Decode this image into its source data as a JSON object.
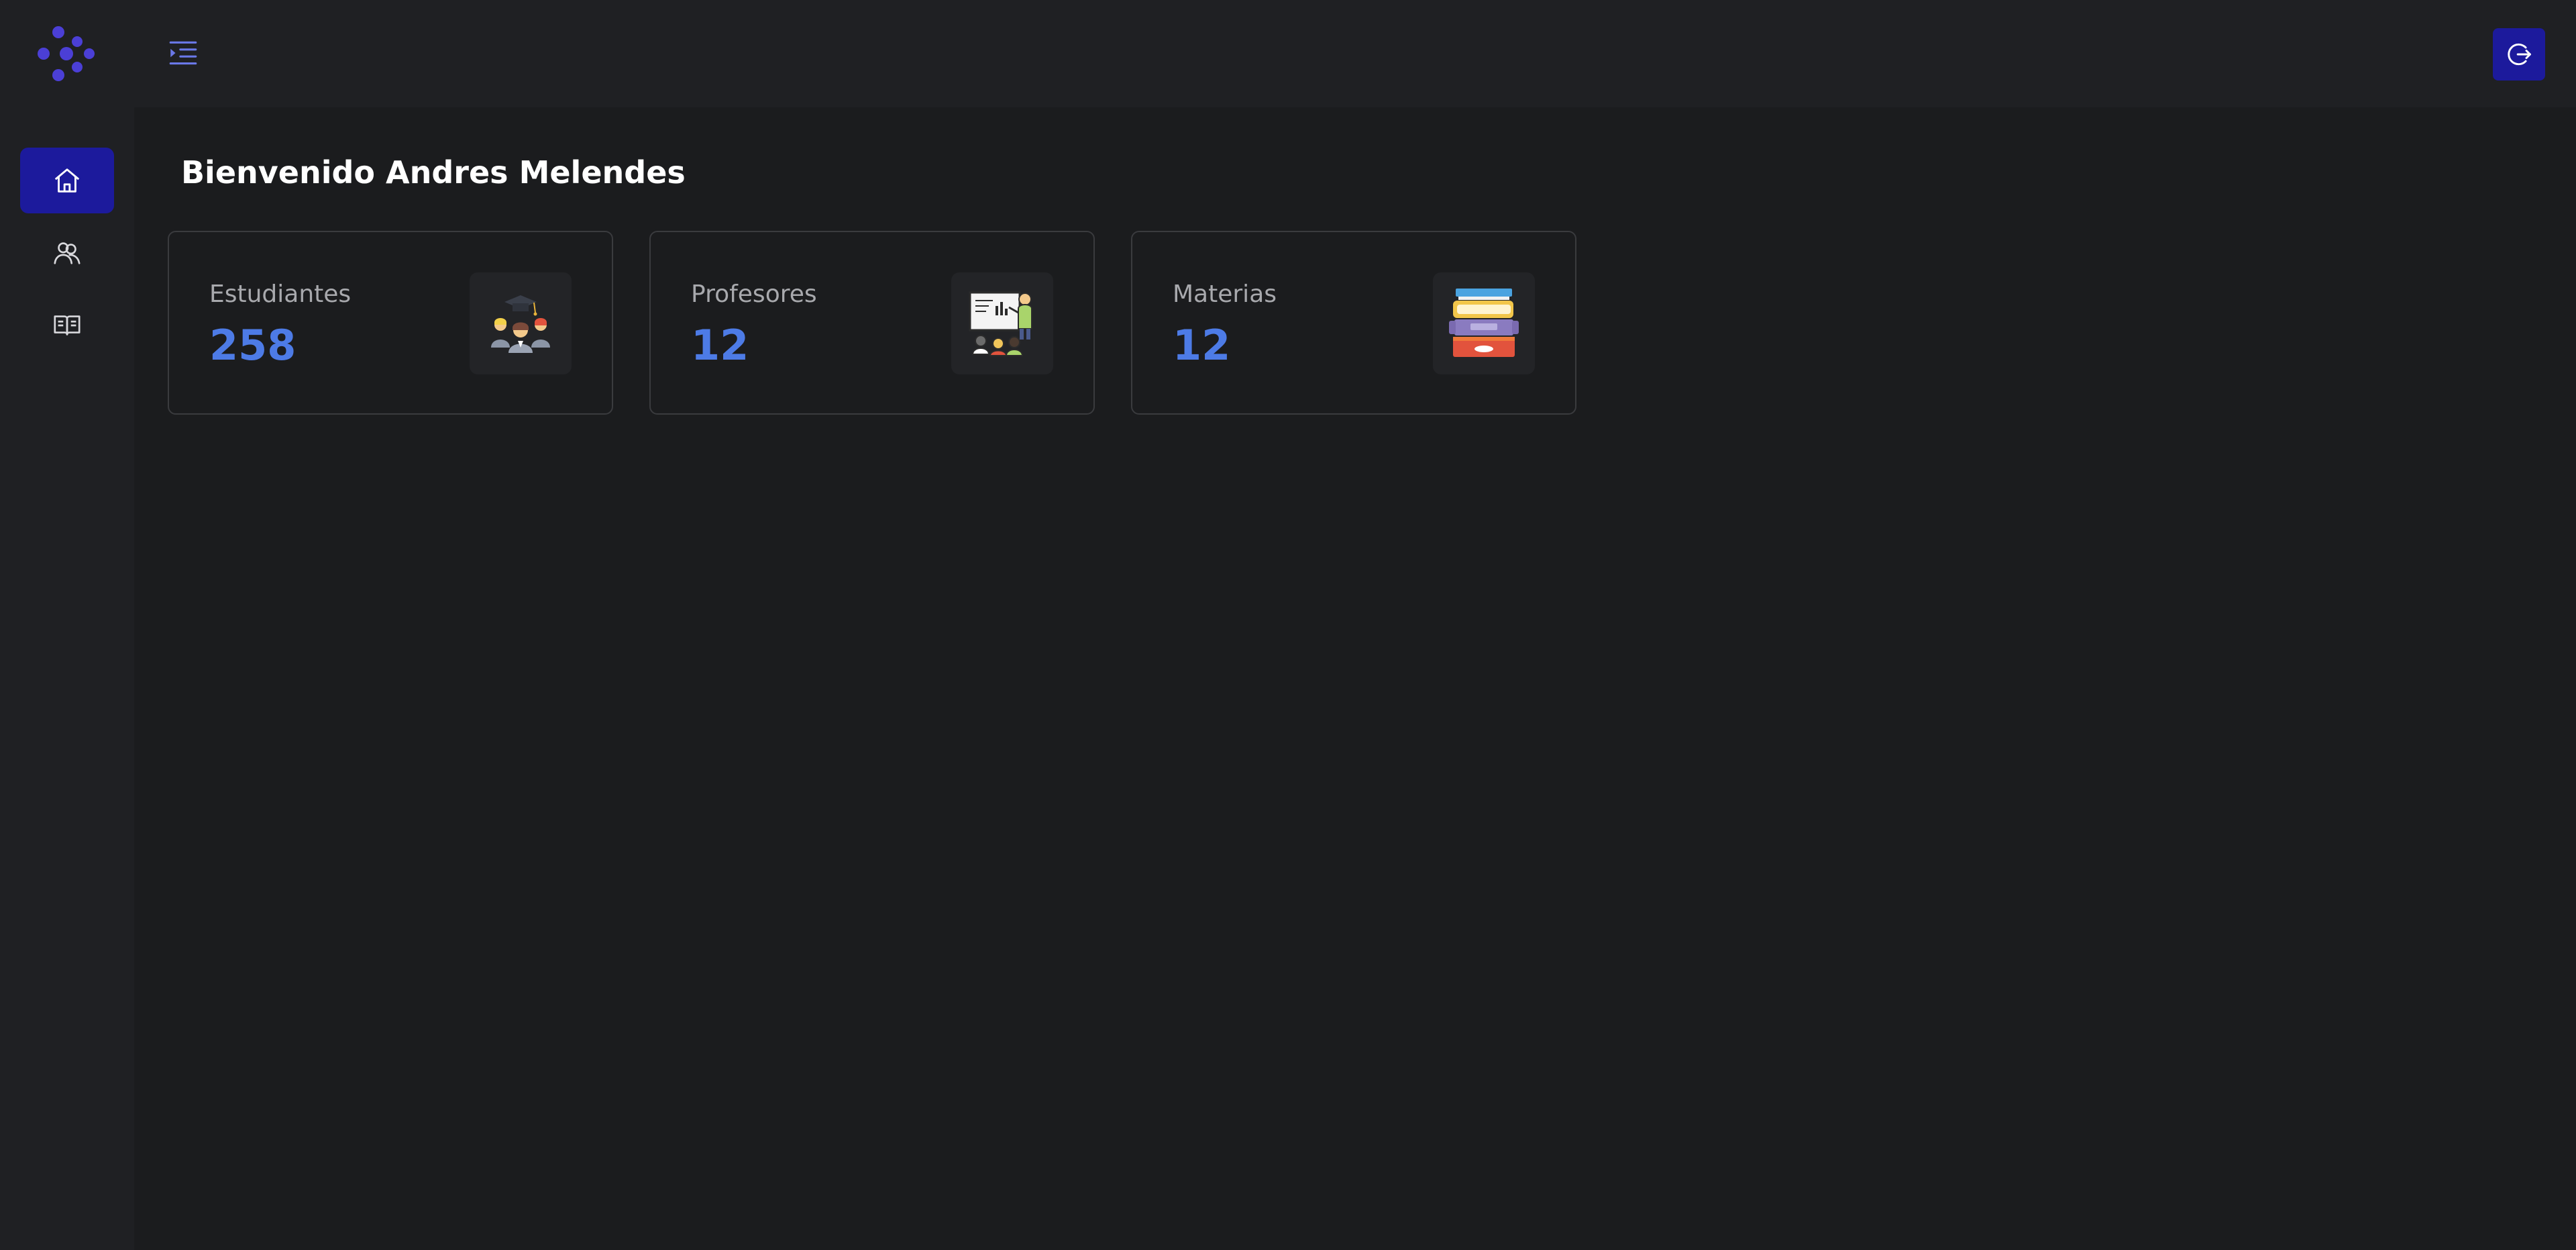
{
  "header": {
    "menu_toggle_icon": "menu-toggle-icon",
    "logout_icon": "logout-icon"
  },
  "sidebar": {
    "logo_icon": "dots-logo-icon",
    "items": [
      {
        "icon": "home-icon",
        "active": true
      },
      {
        "icon": "users-icon",
        "active": false
      },
      {
        "icon": "book-icon",
        "active": false
      }
    ]
  },
  "main": {
    "welcome": "Bienvenido Andres Melendes",
    "cards": [
      {
        "label": "Estudiantes",
        "value": "258",
        "icon": "students-icon"
      },
      {
        "label": "Profesores",
        "value": "12",
        "icon": "teacher-icon"
      },
      {
        "label": "Materias",
        "value": "12",
        "icon": "books-icon"
      }
    ]
  },
  "colors": {
    "background": "#1b1c1e",
    "panel": "#1f2023",
    "accent": "#1c1a9c",
    "value": "#4d7be6",
    "logo": "#4b3fd6"
  }
}
